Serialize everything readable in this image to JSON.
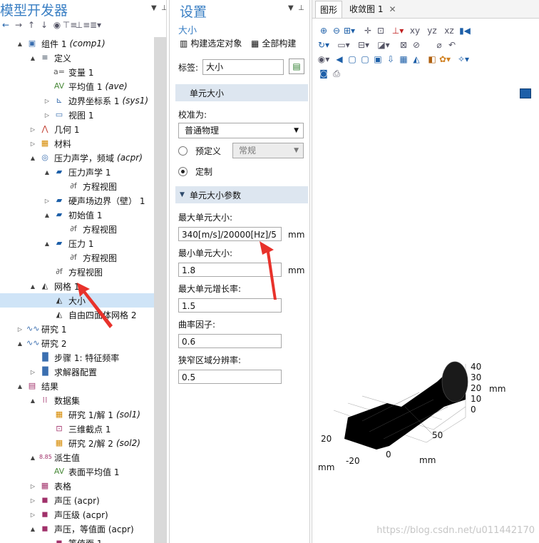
{
  "left": {
    "title": "模型开发器",
    "tree": [
      {
        "label": "组件 1",
        "suffix": "(comp1)",
        "depth": 1,
        "exp": "▲",
        "icon": "component-icon",
        "glyph": "▣",
        "color": "#3b6fb0"
      },
      {
        "label": "定义",
        "depth": 2,
        "exp": "▲",
        "icon": "definitions-icon",
        "glyph": "≡",
        "color": "#345"
      },
      {
        "label": "变量 1",
        "depth": 3,
        "exp": "",
        "icon": "variables-icon",
        "glyph": "a=",
        "color": "#555"
      },
      {
        "label": "平均值 1",
        "suffix": "(ave)",
        "depth": 3,
        "exp": "",
        "icon": "average-icon",
        "glyph": "AV",
        "color": "#4a8a3a"
      },
      {
        "label": "边界坐标系 1",
        "suffix": "(sys1)",
        "depth": 3,
        "exp": "▷",
        "icon": "coordinate-system-icon",
        "glyph": "⊾",
        "color": "#3b6fb0"
      },
      {
        "label": "视图 1",
        "depth": 3,
        "exp": "▷",
        "icon": "view-icon",
        "glyph": "▭",
        "color": "#3b6fb0"
      },
      {
        "label": "几何 1",
        "depth": 2,
        "exp": "▷",
        "icon": "geometry-icon",
        "glyph": "⋀",
        "color": "#c0392b"
      },
      {
        "label": "材料",
        "depth": 2,
        "exp": "▷",
        "icon": "materials-icon",
        "glyph": "▦",
        "color": "#d68a00"
      },
      {
        "label": "压力声学，频域",
        "suffix": "(acpr)",
        "depth": 2,
        "exp": "▲",
        "icon": "acoustics-icon",
        "glyph": "◎",
        "color": "#3b6fb0"
      },
      {
        "label": "压力声学 1",
        "depth": 3,
        "exp": "▲",
        "icon": "domain-feature-icon",
        "glyph": "▰",
        "color": "#1d5fa8"
      },
      {
        "label": "方程视图",
        "depth": 4,
        "exp": "",
        "icon": "equation-icon",
        "glyph": "∂f",
        "color": "#555"
      },
      {
        "label": "硬声场边界（壁） 1",
        "depth": 3,
        "exp": "▷",
        "icon": "boundary-icon",
        "glyph": "▰",
        "color": "#1d5fa8"
      },
      {
        "label": "初始值 1",
        "depth": 3,
        "exp": "▲",
        "icon": "initial-values-icon",
        "glyph": "▰",
        "color": "#1d5fa8"
      },
      {
        "label": "方程视图",
        "depth": 4,
        "exp": "",
        "icon": "equation-icon",
        "glyph": "∂f",
        "color": "#555"
      },
      {
        "label": "压力 1",
        "depth": 3,
        "exp": "▲",
        "icon": "pressure-icon",
        "glyph": "▰",
        "color": "#1d5fa8"
      },
      {
        "label": "方程视图",
        "depth": 4,
        "exp": "",
        "icon": "equation-icon",
        "glyph": "∂f",
        "color": "#555"
      },
      {
        "label": "方程视图",
        "depth": 3,
        "exp": "",
        "icon": "equation-icon",
        "glyph": "∂f",
        "color": "#555"
      },
      {
        "label": "网格 1",
        "depth": 2,
        "exp": "▲",
        "icon": "mesh-icon",
        "glyph": "◭",
        "color": "#333"
      },
      {
        "label": "大小",
        "depth": 3,
        "exp": "",
        "icon": "size-icon",
        "glyph": "◭",
        "color": "#333",
        "selected": true
      },
      {
        "label": "自由四面体网格 2",
        "depth": 3,
        "exp": "",
        "icon": "free-tet-icon",
        "glyph": "◭",
        "color": "#333"
      },
      {
        "label": "研究 1",
        "depth": 1,
        "exp": "▷",
        "icon": "study-icon",
        "glyph": "∿∿",
        "color": "#3b6fb0"
      },
      {
        "label": "研究 2",
        "depth": 1,
        "exp": "▲",
        "icon": "study-icon",
        "glyph": "∿∿",
        "color": "#3b6fb0"
      },
      {
        "label": "步骤 1: 特征频率",
        "depth": 2,
        "exp": "",
        "icon": "step-icon",
        "glyph": "▐▌",
        "color": "#3b6fb0"
      },
      {
        "label": "求解器配置",
        "depth": 2,
        "exp": "▷",
        "icon": "solver-icon",
        "glyph": "▐▌",
        "color": "#3b6fb0"
      },
      {
        "label": "结果",
        "depth": 1,
        "exp": "▲",
        "icon": "results-icon",
        "glyph": "▤",
        "color": "#a0306a"
      },
      {
        "label": "数据集",
        "depth": 2,
        "exp": "▲",
        "icon": "datasets-icon",
        "glyph": "⁞⁞",
        "color": "#a0306a"
      },
      {
        "label": "研究 1/解 1",
        "suffix": "(sol1)",
        "depth": 3,
        "exp": "",
        "icon": "solution-icon",
        "glyph": "▦",
        "color": "#d68a00"
      },
      {
        "label": "三维截点 1",
        "depth": 3,
        "exp": "",
        "icon": "cutpoint-icon",
        "glyph": "⊡",
        "color": "#a0306a"
      },
      {
        "label": "研究 2/解 2",
        "suffix": "(sol2)",
        "depth": 3,
        "exp": "",
        "icon": "solution-icon",
        "glyph": "▦",
        "color": "#d68a00"
      },
      {
        "label": "派生值",
        "depth": 2,
        "exp": "▲",
        "icon": "derived-values-icon",
        "glyph": "8.85",
        "color": "#a0306a"
      },
      {
        "label": "表面平均值 1",
        "depth": 3,
        "exp": "",
        "icon": "average-icon",
        "glyph": "AV",
        "color": "#4a8a3a"
      },
      {
        "label": "表格",
        "depth": 2,
        "exp": "▷",
        "icon": "tables-icon",
        "glyph": "▦",
        "color": "#a0306a"
      },
      {
        "label": "声压 (acpr)",
        "depth": 2,
        "exp": "▷",
        "icon": "plot-group-icon",
        "glyph": "◼",
        "color": "#a0306a"
      },
      {
        "label": "声压级 (acpr)",
        "depth": 2,
        "exp": "▷",
        "icon": "plot-group-icon",
        "glyph": "◼",
        "color": "#a0306a"
      },
      {
        "label": "声压，等值面 (acpr)",
        "depth": 2,
        "exp": "▲",
        "icon": "plot-group-icon",
        "glyph": "◼",
        "color": "#a0306a"
      },
      {
        "label": "等值面 1",
        "depth": 3,
        "exp": "",
        "icon": "isosurface-icon",
        "glyph": "◼",
        "color": "#a0306a"
      }
    ]
  },
  "settings": {
    "title": "设置",
    "subtitle": "大小",
    "build_selected": "构建选定对象",
    "build_all": "全部构建",
    "label_caption": "标签:",
    "label_value": "大小",
    "section_element_size": "单元大小",
    "calibrate_caption": "校准为:",
    "calibrate_value": "普通物理",
    "radio_predefined": "预定义",
    "predefined_value": "常规",
    "radio_custom": "定制",
    "section_params": "单元大小参数",
    "max_size_caption": "最大单元大小:",
    "max_size_value": "340[m/s]/20000[Hz]/5",
    "min_size_caption": "最小单元大小:",
    "min_size_value": "1.8",
    "growth_caption": "最大单元增长率:",
    "growth_value": "1.5",
    "curvature_caption": "曲率因子:",
    "curvature_value": "0.6",
    "narrow_caption": "狭窄区域分辨率:",
    "narrow_value": "0.5",
    "unit_mm": "mm"
  },
  "graphics": {
    "tab_graphics": "图形",
    "tab_convergence": "收敛图 1",
    "axis_z_ticks": [
      "40",
      "30",
      "20",
      "10",
      "0"
    ],
    "axis_x_ticks": [
      "20",
      "0",
      "-20"
    ],
    "axis_y_ticks": [
      "50"
    ],
    "axis_unit": "mm"
  },
  "watermark": "https://blog.csdn.net/u011442170"
}
